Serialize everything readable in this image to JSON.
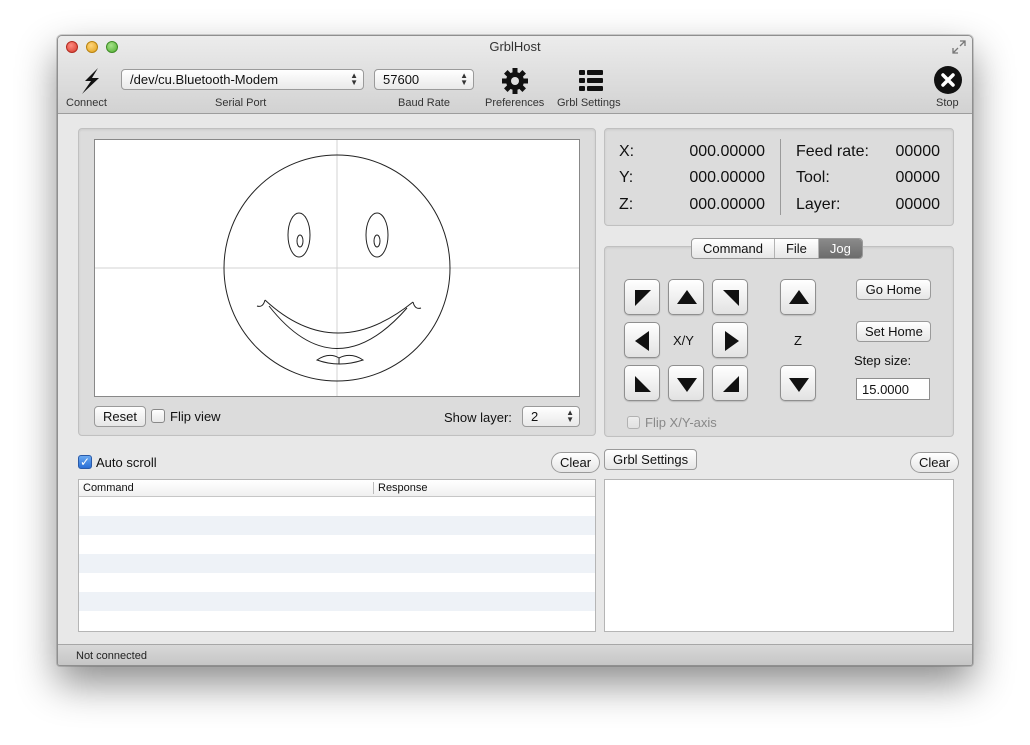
{
  "window": {
    "title": "GrblHost"
  },
  "toolbar": {
    "connect_label": "Connect",
    "serial_port_value": "/dev/cu.Bluetooth-Modem",
    "serial_port_label": "Serial Port",
    "baud_rate_value": "57600",
    "baud_rate_label": "Baud Rate",
    "preferences_label": "Preferences",
    "grbl_settings_label": "Grbl Settings",
    "stop_label": "Stop"
  },
  "preview": {
    "reset_label": "Reset",
    "flip_view_label": "Flip view",
    "flip_view_checked": false,
    "show_layer_label": "Show layer:",
    "show_layer_value": "2"
  },
  "coordinates": {
    "x_label": "X:",
    "x_value": "000.00000",
    "y_label": "Y:",
    "y_value": "000.00000",
    "z_label": "Z:",
    "z_value": "000.00000",
    "feed_label": "Feed rate:",
    "feed_value": "00000",
    "tool_label": "Tool:",
    "tool_value": "00000",
    "layer_label": "Layer:",
    "layer_value": "00000"
  },
  "tabs": [
    {
      "label": "Command",
      "active": false
    },
    {
      "label": "File",
      "active": false
    },
    {
      "label": "Jog",
      "active": true
    }
  ],
  "jog": {
    "xy_label": "X/Y",
    "z_label": "Z",
    "go_home_label": "Go Home",
    "set_home_label": "Set Home",
    "step_size_label": "Step size:",
    "step_size_value": "15.0000",
    "flip_axis_label": "Flip X/Y-axis",
    "flip_axis_checked": false
  },
  "log": {
    "auto_scroll_label": "Auto scroll",
    "auto_scroll_checked": true,
    "clear_label": "Clear",
    "columns": [
      "Command",
      "Response"
    ]
  },
  "settings_panel": {
    "button_label": "Grbl Settings",
    "clear_label": "Clear"
  },
  "status": {
    "text": "Not connected"
  },
  "icons": {
    "connect": "lightning-icon",
    "preferences": "gear-icon",
    "grbl_settings": "list-icon",
    "stop": "stop-icon"
  }
}
